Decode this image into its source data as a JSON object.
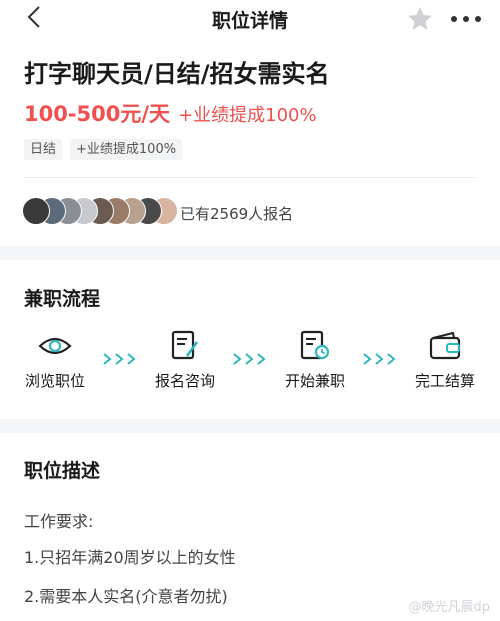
{
  "nav": {
    "title": "职位详情",
    "back_icon": "chevron-left-icon",
    "favorite_icon": "star-icon",
    "more_icon": "more-dots-icon"
  },
  "job": {
    "title": "打字聊天员/日结/招女需实名",
    "salary": "100-500元/天",
    "bonus": "+业绩提成100%",
    "tags": [
      "日结",
      "+业绩提成100%"
    ]
  },
  "applicants": {
    "text": "已有2569人报名",
    "avatar_colors": [
      "#3a3a3a",
      "#5b6b7a",
      "#8a8f96",
      "#c7c9cc",
      "#6b5a50",
      "#9a7b68",
      "#b8a08e",
      "#4a4a4a",
      "#d8b5a0"
    ]
  },
  "process": {
    "title": "兼职流程",
    "steps": [
      {
        "label": "浏览职位",
        "icon": "eye-icon"
      },
      {
        "label": "报名咨询",
        "icon": "document-edit-icon"
      },
      {
        "label": "开始兼职",
        "icon": "document-clock-icon"
      },
      {
        "label": "完工结算",
        "icon": "wallet-icon"
      }
    ],
    "accent_color": "#2fb7bf"
  },
  "description": {
    "title": "职位描述",
    "heading": "工作要求:",
    "items": [
      "1.只招年满20周岁以上的女性",
      "2.需要本人实名(介意者勿扰)"
    ]
  },
  "watermark": "@晚光凡晨dp"
}
